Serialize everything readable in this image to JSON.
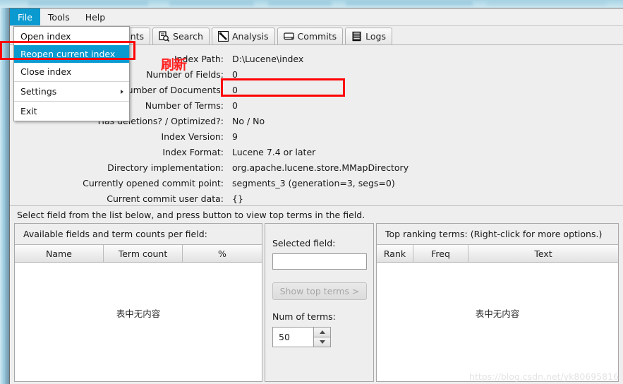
{
  "colors": {
    "menu_highlight": "#0a9ad0",
    "annotation_red": "#ff0000",
    "window_bg": "#eeeeee",
    "desktop_blue": "#b9dce8"
  },
  "menubar": {
    "items": [
      {
        "label": "File",
        "active": true
      },
      {
        "label": "Tools",
        "active": false
      },
      {
        "label": "Help",
        "active": false
      }
    ]
  },
  "file_menu": {
    "items": [
      {
        "label": "Open index",
        "selected": false,
        "submenu": false
      },
      {
        "label": "Reopen current index",
        "selected": true,
        "submenu": false
      },
      {
        "label": "Close index",
        "selected": false,
        "submenu": false
      },
      {
        "label": "Settings",
        "selected": false,
        "submenu": true
      },
      {
        "label": "Exit",
        "selected": false,
        "submenu": false
      }
    ]
  },
  "tabs": [
    {
      "label": "ents",
      "icon": "documents-icon"
    },
    {
      "label": "Search",
      "icon": "search-icon"
    },
    {
      "label": "Analysis",
      "icon": "analysis-icon"
    },
    {
      "label": "Commits",
      "icon": "commits-icon"
    },
    {
      "label": "Logs",
      "icon": "logs-icon"
    }
  ],
  "index_info": {
    "rows": [
      {
        "label": "Index Path:",
        "value": "D:\\Lucene\\index"
      },
      {
        "label": "Number of Fields:",
        "value": "0"
      },
      {
        "label": "Number of Documents:",
        "value": "0"
      },
      {
        "label": "Number of Terms:",
        "value": "0"
      },
      {
        "label": "Has deletions? / Optimized?:",
        "value": "No / No"
      },
      {
        "label": "Index Version:",
        "value": "9"
      },
      {
        "label": "Index Format:",
        "value": "Lucene 7.4 or later"
      },
      {
        "label": "Directory implementation:",
        "value": "org.apache.lucene.store.MMapDirectory"
      },
      {
        "label": "Currently opened commit point:",
        "value": "segments_3 (generation=3, segs=0)"
      },
      {
        "label": "Current commit user data:",
        "value": "{}"
      }
    ]
  },
  "annotations": {
    "chinese_note": "刷新"
  },
  "hint": {
    "text": "Select field from the list below, and press button to view top terms in the field."
  },
  "fields_panel": {
    "title": "Available fields and term counts per field:",
    "columns": [
      "Name",
      "Term count",
      "%"
    ],
    "empty_text": "表中无内容",
    "rows": []
  },
  "selected_field_panel": {
    "label": "Selected field:",
    "value": "",
    "placeholder": "",
    "button_label": "Show top terms >",
    "num_terms_label": "Num of terms:",
    "num_terms_value": "50"
  },
  "terms_panel": {
    "title": "Top ranking terms: (Right-click for more options.)",
    "columns": [
      "Rank",
      "Freq",
      "Text"
    ],
    "empty_text": "表中无内容",
    "rows": []
  },
  "watermark": {
    "text": "https://blog.csdn.net/yk80695816"
  }
}
